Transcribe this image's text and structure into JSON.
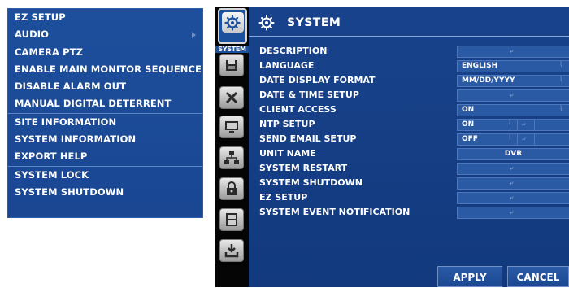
{
  "context_menu": {
    "items": [
      {
        "label": "EZ SETUP"
      },
      {
        "label": "AUDIO"
      },
      {
        "label": "CAMERA PTZ"
      },
      {
        "label": "ENABLE MAIN MONITOR SEQUENCE"
      },
      {
        "label": "DISABLE ALARM OUT"
      },
      {
        "label": "MANUAL DIGITAL DETERRENT"
      },
      {
        "label": "SITE INFORMATION"
      },
      {
        "label": "SYSTEM INFORMATION"
      },
      {
        "label": "EXPORT HELP"
      },
      {
        "label": "SYSTEM LOCK"
      },
      {
        "label": "SYSTEM SHUTDOWN"
      }
    ]
  },
  "tabs": {
    "active_label": "SYSTEM",
    "icons": [
      "gear-icon",
      "storage-icon",
      "tools-icon",
      "monitor-icon",
      "network-icon",
      "lock-icon",
      "hdd-icon",
      "download-icon"
    ]
  },
  "panel": {
    "title": "SYSTEM",
    "rows": [
      {
        "label": "DESCRIPTION",
        "type": "enter"
      },
      {
        "label": "LANGUAGE",
        "type": "select",
        "value": "ENGLISH"
      },
      {
        "label": "DATE DISPLAY FORMAT",
        "type": "select",
        "value": "MM/DD/YYYY"
      },
      {
        "label": "DATE & TIME SETUP",
        "type": "enter"
      },
      {
        "label": "CLIENT ACCESS",
        "type": "select",
        "value": "ON"
      },
      {
        "label": "NTP SETUP",
        "type": "split",
        "value": "ON"
      },
      {
        "label": "SEND EMAIL SETUP",
        "type": "split",
        "value": "OFF"
      },
      {
        "label": "UNIT NAME",
        "type": "text",
        "value": "DVR"
      },
      {
        "label": "SYSTEM RESTART",
        "type": "enter"
      },
      {
        "label": "SYSTEM SHUTDOWN",
        "type": "enter"
      },
      {
        "label": "EZ SETUP",
        "type": "enter"
      },
      {
        "label": "SYSTEM EVENT NOTIFICATION",
        "type": "enter"
      }
    ],
    "apply_label": "APPLY",
    "cancel_label": "CANCEL"
  }
}
